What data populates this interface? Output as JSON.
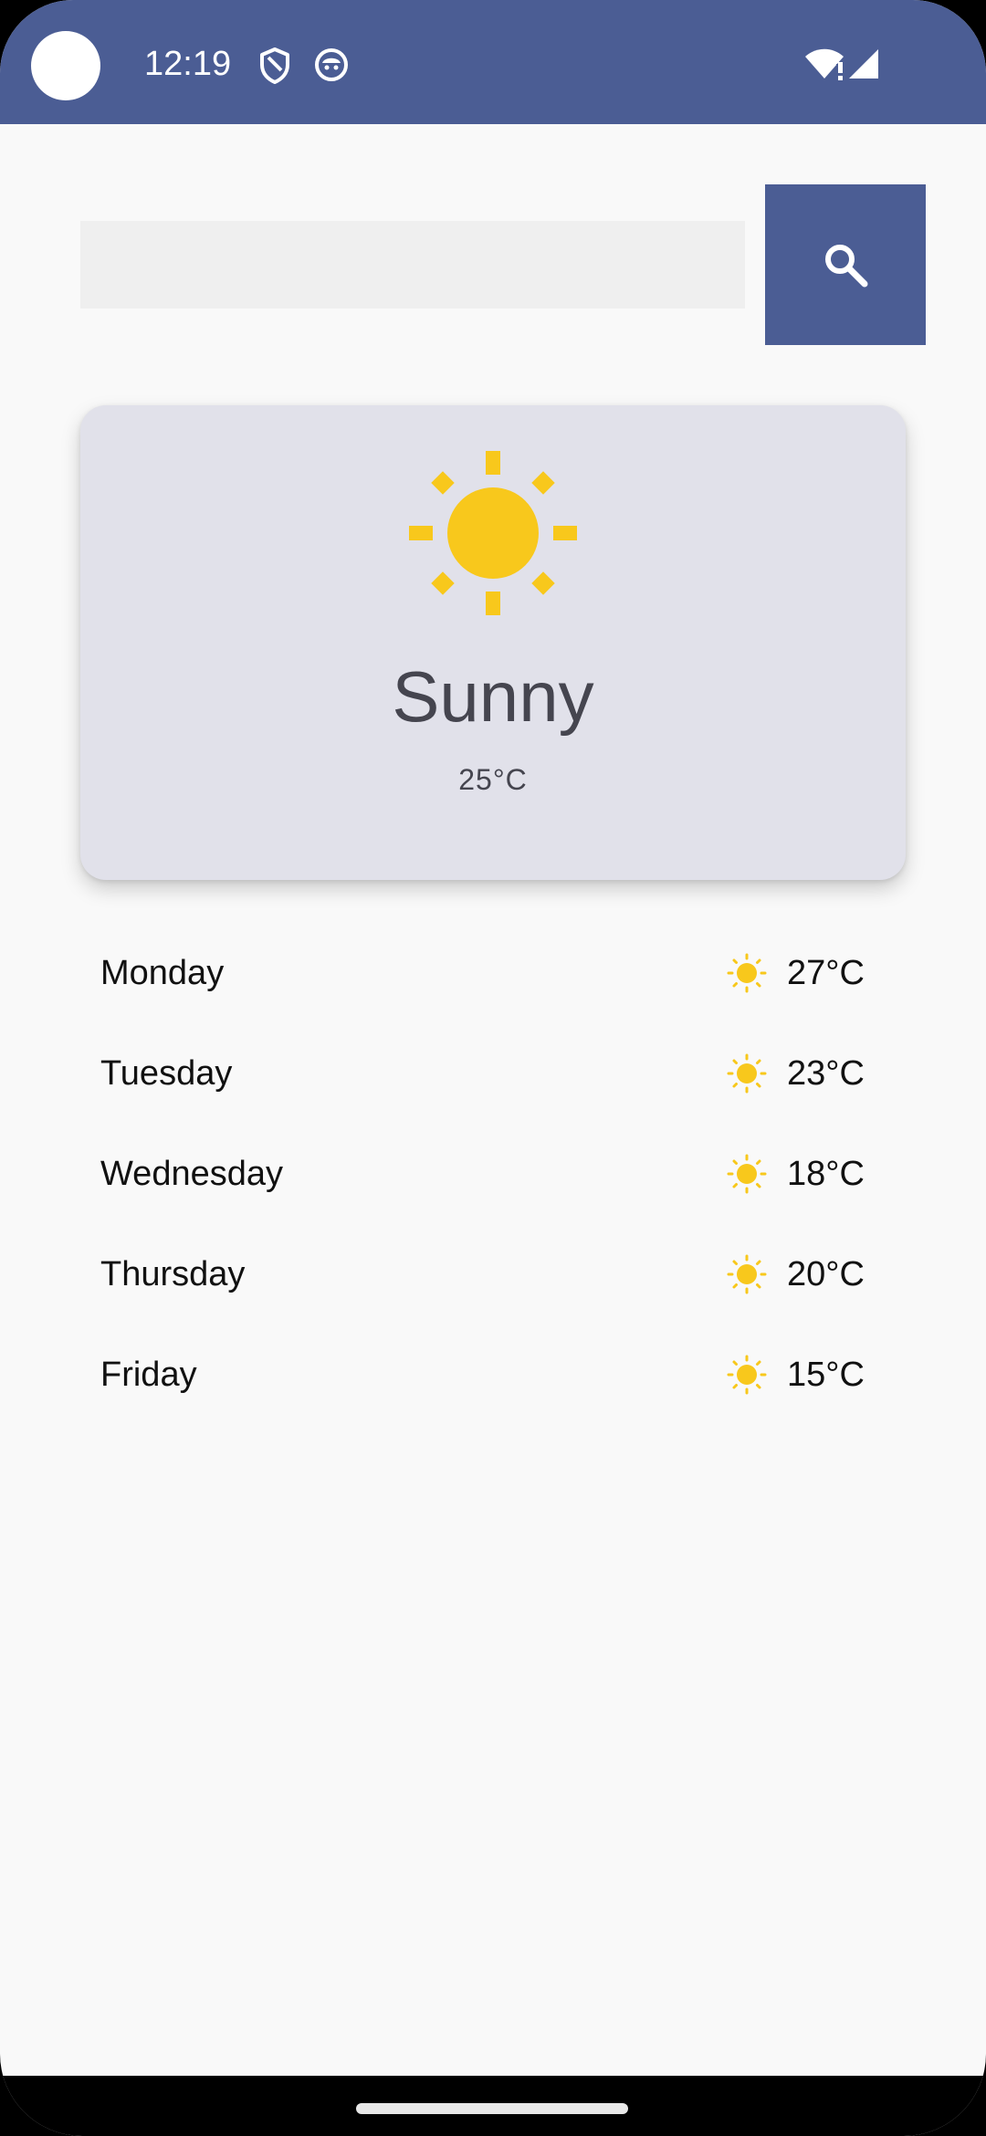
{
  "status_bar": {
    "time": "12:19",
    "icons": [
      "shield-icon",
      "face-icon",
      "wifi-icon",
      "cell-signal-icon"
    ]
  },
  "search": {
    "value": "",
    "placeholder": "",
    "button_icon": "search-icon"
  },
  "current": {
    "icon": "sun-icon",
    "condition": "Sunny",
    "temperature": "25°C"
  },
  "forecast": [
    {
      "day": "Monday",
      "icon": "sun-icon",
      "temp": "27°C"
    },
    {
      "day": "Tuesday",
      "icon": "sun-icon",
      "temp": "23°C"
    },
    {
      "day": "Wednesday",
      "icon": "sun-icon",
      "temp": "18°C"
    },
    {
      "day": "Thursday",
      "icon": "sun-icon",
      "temp": "20°C"
    },
    {
      "day": "Friday",
      "icon": "sun-icon",
      "temp": "15°C"
    }
  ],
  "colors": {
    "primary": "#4b5d94",
    "card_background": "#e1e1ea",
    "sun": "#f8c81c",
    "background": "#f9f9f9"
  }
}
